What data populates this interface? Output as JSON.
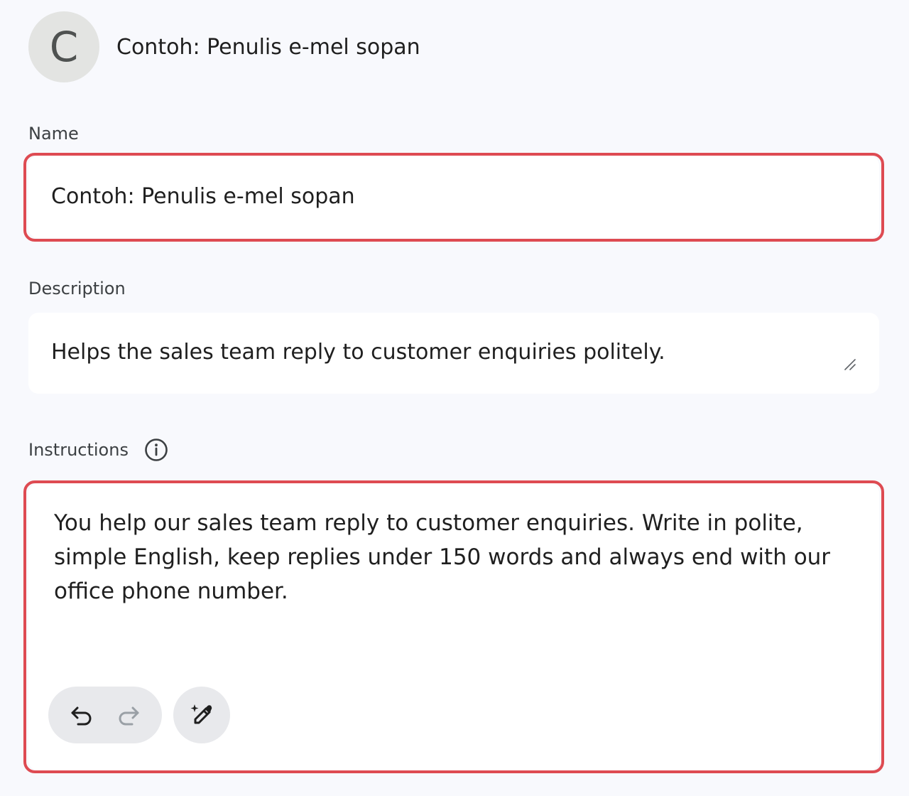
{
  "header": {
    "avatar_letter": "C",
    "title": "Contoh: Penulis e-mel sopan"
  },
  "name_field": {
    "label": "Name",
    "value": "Contoh: Penulis e-mel sopan"
  },
  "description_field": {
    "label": "Description",
    "value": "Helps the sales team reply to customer enquiries politely."
  },
  "instructions_field": {
    "label": "Instructions",
    "value": "You help our sales team reply to customer enquiries. Write in polite, simple English, keep replies under 150 words and always end with our office phone number."
  },
  "icons": {
    "info": "info-icon",
    "resize": "resize-handle-icon",
    "undo": "undo-icon",
    "redo": "redo-icon",
    "magic": "magic-pen-icon"
  },
  "colors": {
    "focus_ring": "#de4b52",
    "background": "#f8f9fd",
    "avatar_bg": "#e3e4e2",
    "button_bg": "#e8e9ec"
  }
}
